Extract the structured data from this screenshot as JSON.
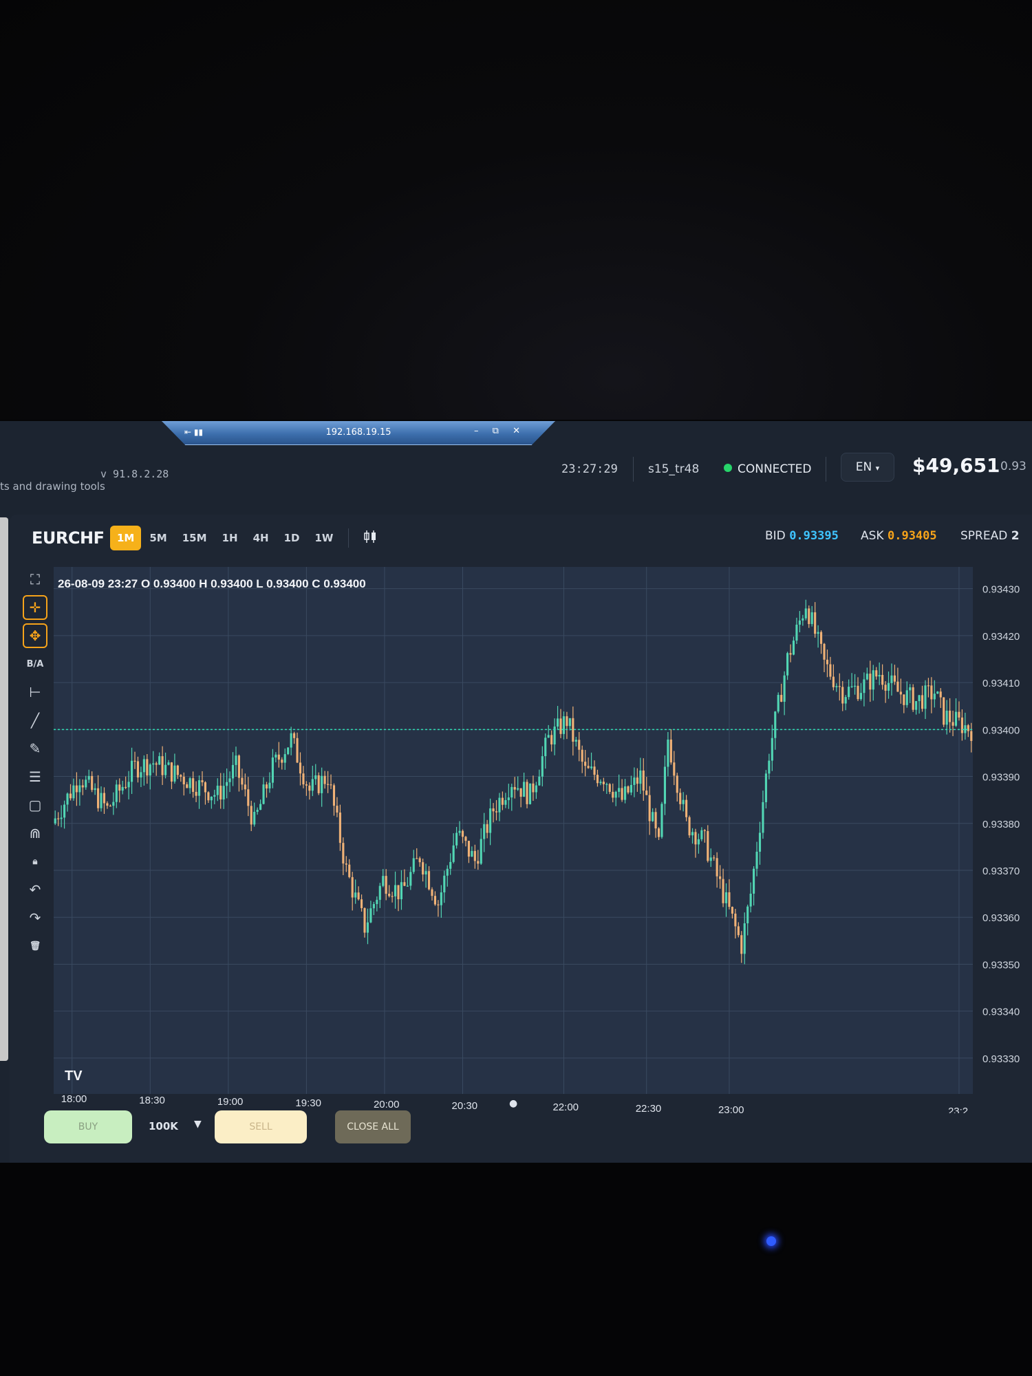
{
  "window": {
    "rdp_host": "192.168.19.15",
    "rdp_controls": "– ⧉ ✕"
  },
  "header": {
    "tools_label": "ts and drawing tools",
    "version": "v 91.8.2.28",
    "clock": "23:27:29",
    "user": "s15_tr48",
    "status": "CONNECTED",
    "status_color": "#27d46a",
    "language": "EN",
    "language_caret": "▾",
    "balance": "$49,651",
    "balance_secondary": "0.93"
  },
  "instrument": {
    "symbol": "EURCHF",
    "timeframes": [
      "1M",
      "5M",
      "15M",
      "1H",
      "4H",
      "1D",
      "1W"
    ],
    "active_timeframe": "1M",
    "chart_type_icon": "candlestick-icon"
  },
  "quote": {
    "bid_label": "BID",
    "bid": "0.93395",
    "bid_color": "#3fc4ff",
    "ask_label": "ASK",
    "ask": "0.93405",
    "ask_color": "#f6a31a",
    "spread_label": "SPREAD",
    "spread": "2"
  },
  "toolbar": {
    "tools": [
      {
        "name": "fullscreen-icon",
        "glyph": "⛶"
      },
      {
        "name": "crosshair-icon",
        "glyph": "✛",
        "active": true
      },
      {
        "name": "move-icon",
        "glyph": "✥",
        "active": true
      },
      {
        "name": "bid-ask-toggle",
        "glyph": "B/A"
      },
      {
        "name": "horizontal-line-icon",
        "glyph": "⊢"
      },
      {
        "name": "trend-line-icon",
        "glyph": "╱"
      },
      {
        "name": "pencil-icon",
        "glyph": "✎"
      },
      {
        "name": "fibonacci-icon",
        "glyph": "☰"
      },
      {
        "name": "rectangle-icon",
        "glyph": "▢"
      },
      {
        "name": "magnet-icon",
        "glyph": "⋒"
      },
      {
        "name": "lock-icon",
        "glyph": "🔒︎"
      },
      {
        "name": "undo-icon",
        "glyph": "↶"
      },
      {
        "name": "redo-icon",
        "glyph": "↷"
      },
      {
        "name": "trash-icon",
        "glyph": "🗑︎"
      }
    ]
  },
  "chart": {
    "ohlc_label": "26-08-09 23:27 O 0.93400 H 0.93400 L 0.93400 C 0.93400",
    "logo": "TV",
    "session_marker": "●"
  },
  "chart_data": {
    "type": "candlestick",
    "x_ticks": [
      "18:00",
      "18:30",
      "19:00",
      "19:30",
      "20:00",
      "20:30",
      "22:00",
      "22:30",
      "23:00",
      "23:2"
    ],
    "y_ticks": [
      "0.93430",
      "0.93420",
      "0.93410",
      "0.93400",
      "0.93390",
      "0.93380",
      "0.93370",
      "0.93360",
      "0.93350",
      "0.93340",
      "0.93330"
    ],
    "y_range": [
      0.93325,
      0.93432
    ],
    "current_price": 0.934,
    "current_price_line_color": "#2fe0b4",
    "up_color": "#52d6b4",
    "down_color": "#f0b277",
    "grid": true,
    "price_path": [
      [
        0,
        0.9338
      ],
      [
        0.03,
        0.9339
      ],
      [
        0.06,
        0.93383
      ],
      [
        0.09,
        0.93392
      ],
      [
        0.11,
        0.93393
      ],
      [
        0.15,
        0.93389
      ],
      [
        0.18,
        0.93386
      ],
      [
        0.2,
        0.93392
      ],
      [
        0.22,
        0.9338
      ],
      [
        0.24,
        0.93392
      ],
      [
        0.26,
        0.93398
      ],
      [
        0.28,
        0.93387
      ],
      [
        0.3,
        0.9339
      ],
      [
        0.32,
        0.9337
      ],
      [
        0.34,
        0.93358
      ],
      [
        0.36,
        0.93368
      ],
      [
        0.38,
        0.93365
      ],
      [
        0.4,
        0.93373
      ],
      [
        0.42,
        0.93363
      ],
      [
        0.44,
        0.93378
      ],
      [
        0.46,
        0.93372
      ],
      [
        0.48,
        0.93383
      ],
      [
        0.5,
        0.93389
      ],
      [
        0.52,
        0.93386
      ],
      [
        0.54,
        0.93398
      ],
      [
        0.56,
        0.93402
      ],
      [
        0.58,
        0.93391
      ],
      [
        0.6,
        0.9339
      ],
      [
        0.62,
        0.93385
      ],
      [
        0.64,
        0.9339
      ],
      [
        0.66,
        0.93375
      ],
      [
        0.67,
        0.93398
      ],
      [
        0.69,
        0.9338
      ],
      [
        0.71,
        0.93376
      ],
      [
        0.73,
        0.93365
      ],
      [
        0.75,
        0.93354
      ],
      [
        0.76,
        0.93365
      ],
      [
        0.78,
        0.93395
      ],
      [
        0.8,
        0.93415
      ],
      [
        0.82,
        0.93427
      ],
      [
        0.84,
        0.93414
      ],
      [
        0.86,
        0.93408
      ],
      [
        0.88,
        0.93409
      ],
      [
        0.9,
        0.93412
      ],
      [
        0.92,
        0.93408
      ],
      [
        0.94,
        0.93406
      ],
      [
        0.96,
        0.93408
      ],
      [
        0.97,
        0.93403
      ],
      [
        0.99,
        0.93401
      ],
      [
        1.0,
        0.934
      ]
    ]
  },
  "trade": {
    "buy_label": "BUY",
    "quantity": "100K",
    "quantity_caret": "▼",
    "sell_label": "SELL",
    "close_all_label": "CLOSE ALL"
  }
}
